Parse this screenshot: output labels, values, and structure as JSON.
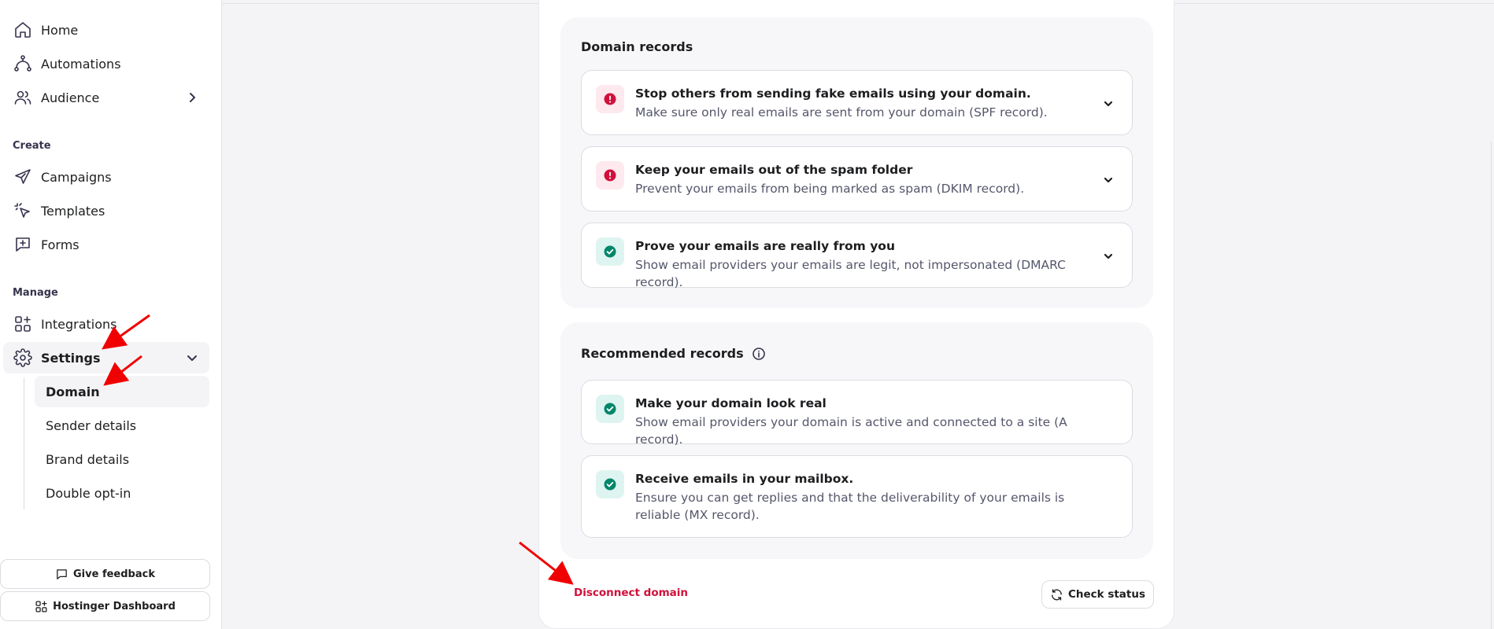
{
  "sidebar": {
    "nav": [
      {
        "label": "Home",
        "icon": "home-icon"
      },
      {
        "label": "Automations",
        "icon": "automations-icon"
      },
      {
        "label": "Audience",
        "icon": "audience-icon"
      }
    ],
    "create_label": "Create",
    "create_items": [
      {
        "label": "Campaigns",
        "icon": "send-icon"
      },
      {
        "label": "Templates",
        "icon": "cursor-click-icon"
      },
      {
        "label": "Forms",
        "icon": "form-icon"
      }
    ],
    "manage_label": "Manage",
    "integrations_label": "Integrations",
    "settings_label": "Settings",
    "settings_sub": [
      "Domain",
      "Sender details",
      "Brand details",
      "Double opt-in"
    ],
    "feedback_button": "Give feedback",
    "dashboard_button": "Hostinger Dashboard"
  },
  "main": {
    "domain_records": {
      "title": "Domain records",
      "items": [
        {
          "title": "Stop others from sending fake emails using your domain.",
          "description": "Make sure only real emails are sent from your domain (SPF record).",
          "status": "error"
        },
        {
          "title": "Keep your emails out of the spam folder",
          "description": "Prevent your emails from being marked as spam (DKIM record).",
          "status": "error"
        },
        {
          "title": "Prove your emails are really from you",
          "description": "Show email providers your emails are legit, not impersonated (DMARC record).",
          "status": "ok"
        }
      ]
    },
    "recommended_records": {
      "title": "Recommended records",
      "items": [
        {
          "title": "Make your domain look real",
          "description": "Show email providers your domain is active and connected to a site (A record).",
          "status": "ok"
        },
        {
          "title": "Receive emails in your mailbox.",
          "description": "Ensure you can get replies and that the deliverability of your emails is reliable (MX record).",
          "status": "ok"
        }
      ]
    },
    "disconnect_label": "Disconnect domain",
    "check_status_label": "Check status"
  },
  "colors": {
    "error": "#d0103a",
    "ok": "#00866a",
    "annotation_arrow": "#f00000"
  }
}
